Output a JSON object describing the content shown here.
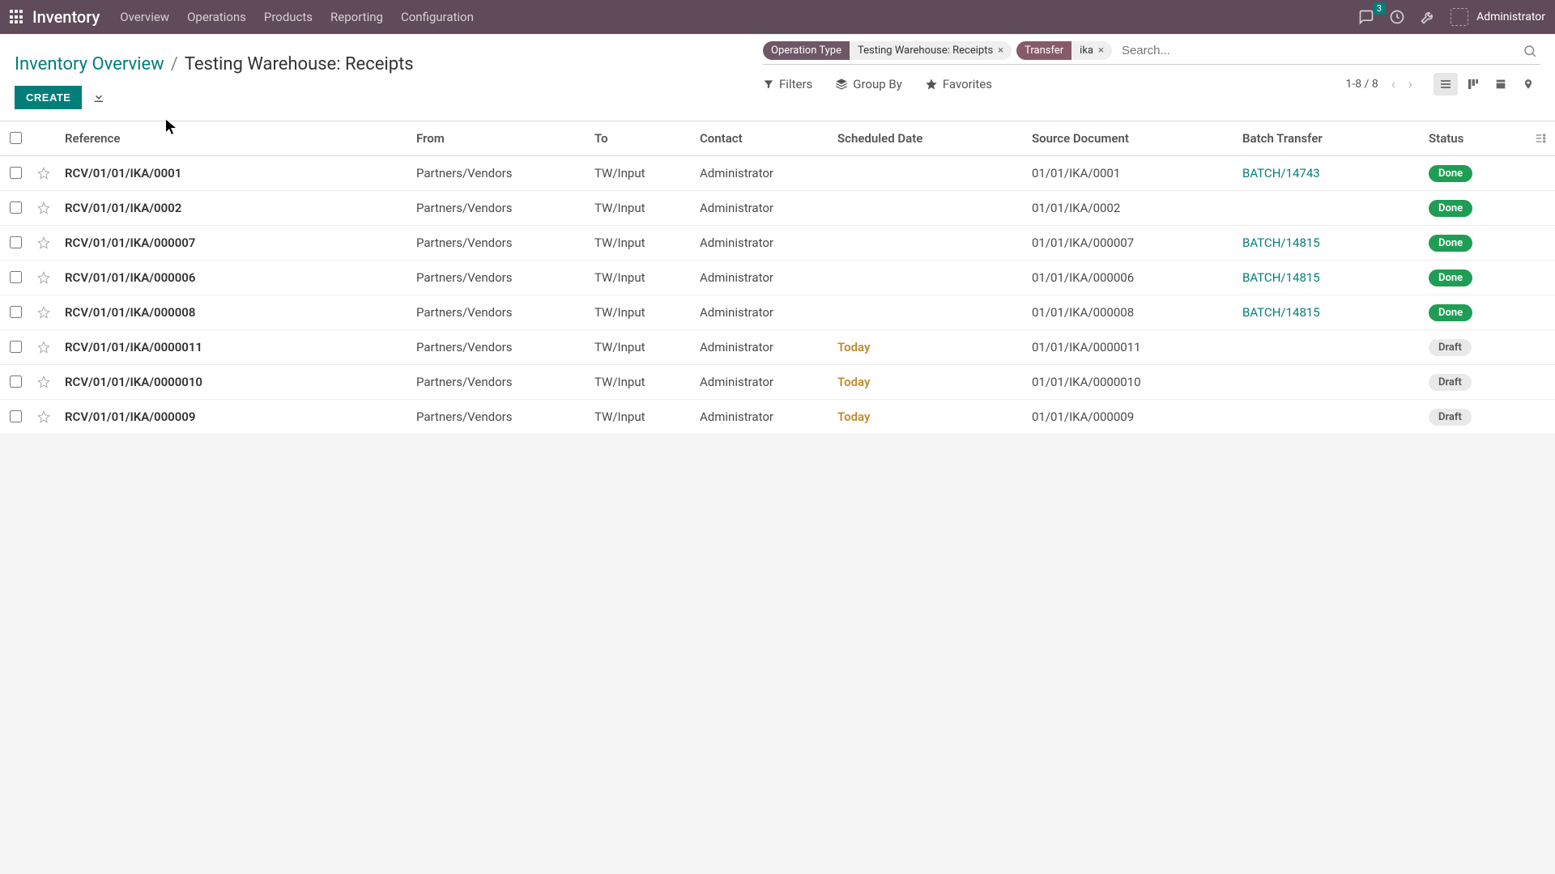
{
  "topbar": {
    "brand": "Inventory",
    "nav": [
      "Overview",
      "Operations",
      "Products",
      "Reporting",
      "Configuration"
    ],
    "msg_count": "3",
    "user": "Administrator"
  },
  "breadcrumb": {
    "root": "Inventory Overview",
    "sep": "/",
    "current": "Testing Warehouse: Receipts"
  },
  "buttons": {
    "create": "CREATE"
  },
  "search": {
    "facets": [
      {
        "k": "Operation Type",
        "v": "Testing Warehouse: Receipts"
      },
      {
        "k": "Transfer",
        "v": "ika"
      }
    ],
    "placeholder": "Search..."
  },
  "toolbar": {
    "filters": "Filters",
    "groupby": "Group By",
    "favorites": "Favorites",
    "pager": "1-8 / 8"
  },
  "columns": [
    "Reference",
    "From",
    "To",
    "Contact",
    "Scheduled Date",
    "Source Document",
    "Batch Transfer",
    "Status"
  ],
  "rows": [
    {
      "ref": "RCV/01/01/IKA/0001",
      "from": "Partners/Vendors",
      "to": "TW/Input",
      "contact": "Administrator",
      "sched": "",
      "src": "01/01/IKA/0001",
      "batch": "BATCH/14743",
      "status": "Done"
    },
    {
      "ref": "RCV/01/01/IKA/0002",
      "from": "Partners/Vendors",
      "to": "TW/Input",
      "contact": "Administrator",
      "sched": "",
      "src": "01/01/IKA/0002",
      "batch": "",
      "status": "Done"
    },
    {
      "ref": "RCV/01/01/IKA/000007",
      "from": "Partners/Vendors",
      "to": "TW/Input",
      "contact": "Administrator",
      "sched": "",
      "src": "01/01/IKA/000007",
      "batch": "BATCH/14815",
      "status": "Done"
    },
    {
      "ref": "RCV/01/01/IKA/000006",
      "from": "Partners/Vendors",
      "to": "TW/Input",
      "contact": "Administrator",
      "sched": "",
      "src": "01/01/IKA/000006",
      "batch": "BATCH/14815",
      "status": "Done"
    },
    {
      "ref": "RCV/01/01/IKA/000008",
      "from": "Partners/Vendors",
      "to": "TW/Input",
      "contact": "Administrator",
      "sched": "",
      "src": "01/01/IKA/000008",
      "batch": "BATCH/14815",
      "status": "Done"
    },
    {
      "ref": "RCV/01/01/IKA/0000011",
      "from": "Partners/Vendors",
      "to": "TW/Input",
      "contact": "Administrator",
      "sched": "Today",
      "src": "01/01/IKA/0000011",
      "batch": "",
      "status": "Draft"
    },
    {
      "ref": "RCV/01/01/IKA/0000010",
      "from": "Partners/Vendors",
      "to": "TW/Input",
      "contact": "Administrator",
      "sched": "Today",
      "src": "01/01/IKA/0000010",
      "batch": "",
      "status": "Draft"
    },
    {
      "ref": "RCV/01/01/IKA/000009",
      "from": "Partners/Vendors",
      "to": "TW/Input",
      "contact": "Administrator",
      "sched": "Today",
      "src": "01/01/IKA/000009",
      "batch": "",
      "status": "Draft"
    }
  ]
}
